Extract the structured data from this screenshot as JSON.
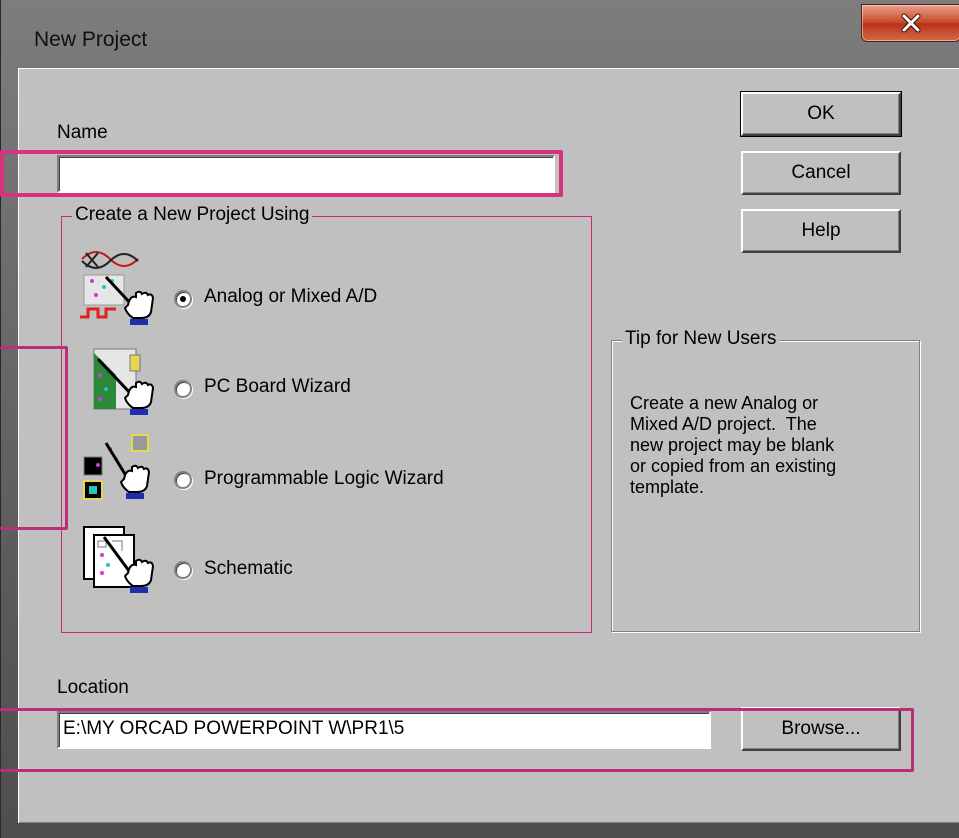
{
  "window": {
    "title": "New Project",
    "close_glyph": "close-icon"
  },
  "name_field": {
    "label": "Name",
    "value": ""
  },
  "buttons": {
    "ok": "OK",
    "cancel": "Cancel",
    "help": "Help",
    "browse": "Browse..."
  },
  "create_group": {
    "title": "Create a New Project Using",
    "options": [
      {
        "label": "Analog or Mixed A/D",
        "selected": true,
        "icon": "analog-mixed-icon"
      },
      {
        "label": "PC Board Wizard",
        "selected": false,
        "icon": "pc-board-icon"
      },
      {
        "label": "Programmable Logic Wizard",
        "selected": false,
        "icon": "programmable-logic-icon"
      },
      {
        "label": "Schematic",
        "selected": false,
        "icon": "schematic-icon"
      }
    ]
  },
  "tip": {
    "title": "Tip for New Users",
    "lines": [
      "Create a new Analog or",
      "Mixed A/D project.  The",
      "new project may be blank",
      "or copied from an existing",
      "template."
    ]
  },
  "location": {
    "label": "Location",
    "value": "E:\\MY ORCAD POWERPOINT W\\PR1\\5"
  },
  "colors": {
    "dialog_bg": "#c0c0c0",
    "highlight": "#d6327f",
    "close_button": "#c9492c"
  }
}
